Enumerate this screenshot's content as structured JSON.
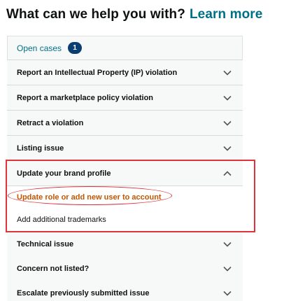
{
  "header": {
    "title": "What can we help you with?",
    "link": "Learn more"
  },
  "open_cases": {
    "label": "Open cases",
    "count": "1"
  },
  "topics": [
    {
      "label": "Report an Intellectual Property (IP) violation",
      "expanded": false
    },
    {
      "label": "Report a marketplace policy violation",
      "expanded": false
    },
    {
      "label": "Retract a violation",
      "expanded": false
    },
    {
      "label": "Listing issue",
      "expanded": false
    },
    {
      "label": "Update your brand profile",
      "expanded": true,
      "subitems": [
        {
          "label": "Update role or add new user to account"
        },
        {
          "label": "Add additional trademarks"
        }
      ]
    },
    {
      "label": "Technical issue",
      "expanded": false
    },
    {
      "label": "Concern not listed?",
      "expanded": false
    },
    {
      "label": "Escalate previously submitted issue",
      "expanded": false
    }
  ],
  "colors": {
    "link": "#007185",
    "badge": "#0b3f73",
    "highlight_text": "#c45500",
    "annotation": "#e0323a"
  },
  "icons": {
    "collapsed": "chevron-down-icon",
    "expanded": "chevron-up-icon"
  }
}
